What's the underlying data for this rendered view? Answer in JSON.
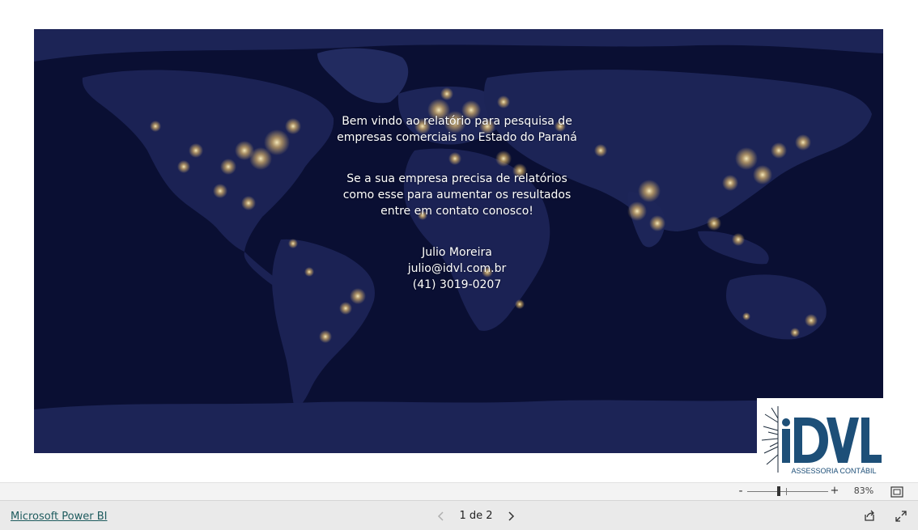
{
  "report": {
    "welcome_lines": [
      "Bem vindo ao relatório para pesquisa de",
      "empresas comerciais no Estado do Paraná"
    ],
    "cta_lines": [
      "Se a sua empresa precisa de relatórios",
      "como esse para aumentar os resultados",
      "entre em contato conosco!"
    ],
    "contact": {
      "name": "Julio Moreira",
      "email": "julio@idvl.com.br",
      "phone": "(41) 3019-0207"
    },
    "background": "night-earth-map",
    "colors": {
      "map_background": "#0a0f33",
      "land": "#1a2150",
      "city_lights": "#f6c86a",
      "text": "#ffffff"
    }
  },
  "logo": {
    "text": "iDVL",
    "subtitle": "ASSESSORIA CONTÁBIL",
    "color": "#1d4f78"
  },
  "zoom": {
    "minus_label": "-",
    "plus_label": "+",
    "level_label": "83%",
    "level": 83
  },
  "footer": {
    "link_label": "Microsoft Power BI",
    "page_indicator": "1 de 2",
    "current_page": 1,
    "total_pages": 2
  },
  "icons": {
    "prev": "chevron-left-icon",
    "next": "chevron-right-icon",
    "fit": "fit-to-page-icon",
    "share": "share-icon",
    "fullscreen": "fullscreen-icon"
  }
}
